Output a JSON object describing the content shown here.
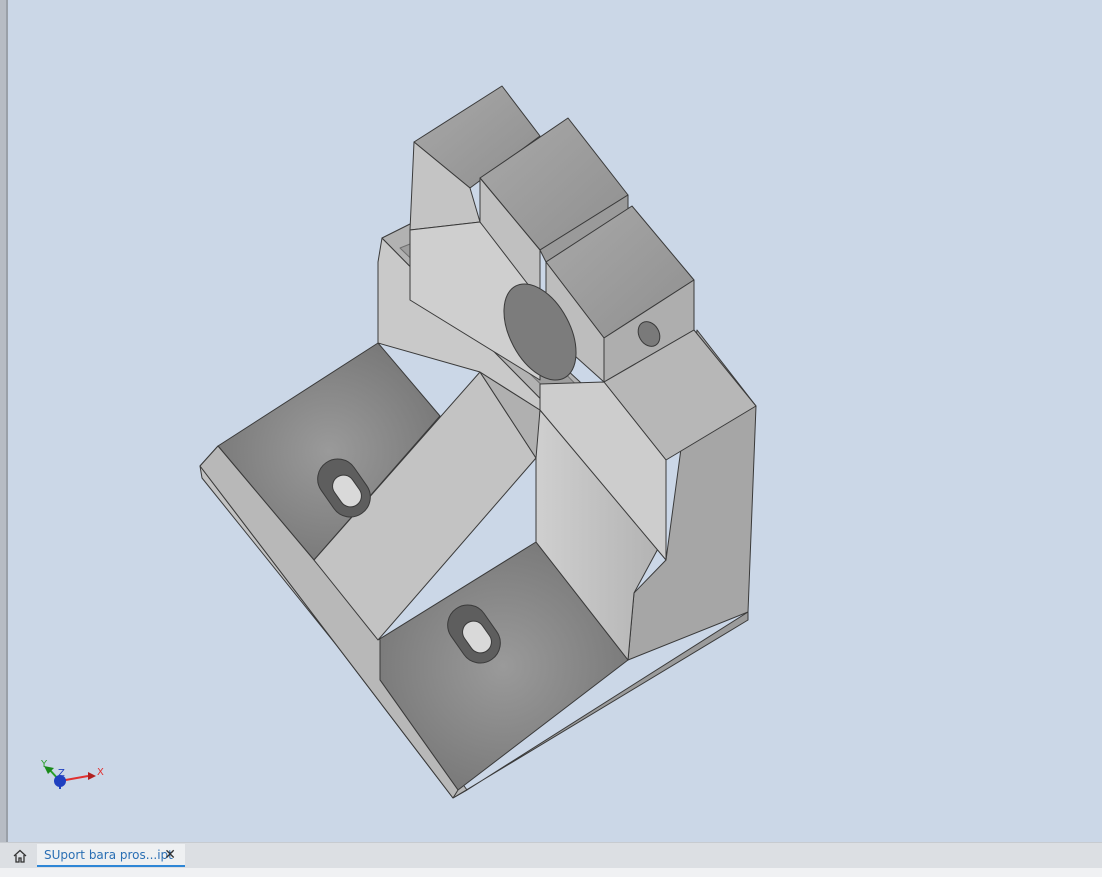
{
  "document_tabs": [
    {
      "label": "SUport bara pros...ipt",
      "close_glyph": "✕",
      "active": true
    }
  ],
  "home_icon": "home-icon",
  "axis_triad": {
    "x_label": "X",
    "y_label": "Y",
    "z_label": "Z"
  },
  "colors": {
    "viewport_background": "#cbd7e7",
    "model_gray": "#a8a8a8",
    "active_tab_accent": "#2e86d6",
    "x_axis": "#e03030",
    "y_axis": "#2aa02a",
    "z_axis": "#2040c0"
  }
}
